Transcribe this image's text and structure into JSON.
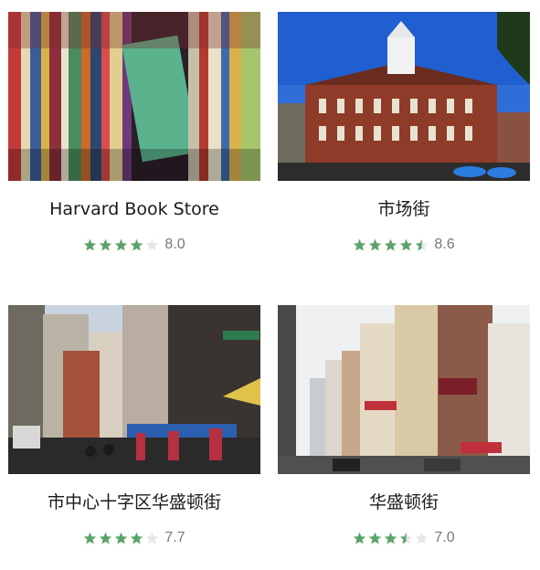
{
  "colors": {
    "star_filled": "#5aa469",
    "star_empty": "#e6e6e6"
  },
  "places": [
    {
      "name": "Harvard Book Store",
      "rating": "8.0",
      "stars": 4.0,
      "image": "bookshelf-photo"
    },
    {
      "name": "市场街",
      "rating": "8.6",
      "stars": 4.5,
      "image": "brick-hall-with-cupola-photo"
    },
    {
      "name": "市中心十字区华盛顿街",
      "rating": "7.7",
      "stars": 4.0,
      "image": "downtown-street-market-photo"
    },
    {
      "name": "华盛顿街",
      "rating": "7.0",
      "stars": 3.5,
      "image": "city-street-buildings-photo"
    }
  ]
}
